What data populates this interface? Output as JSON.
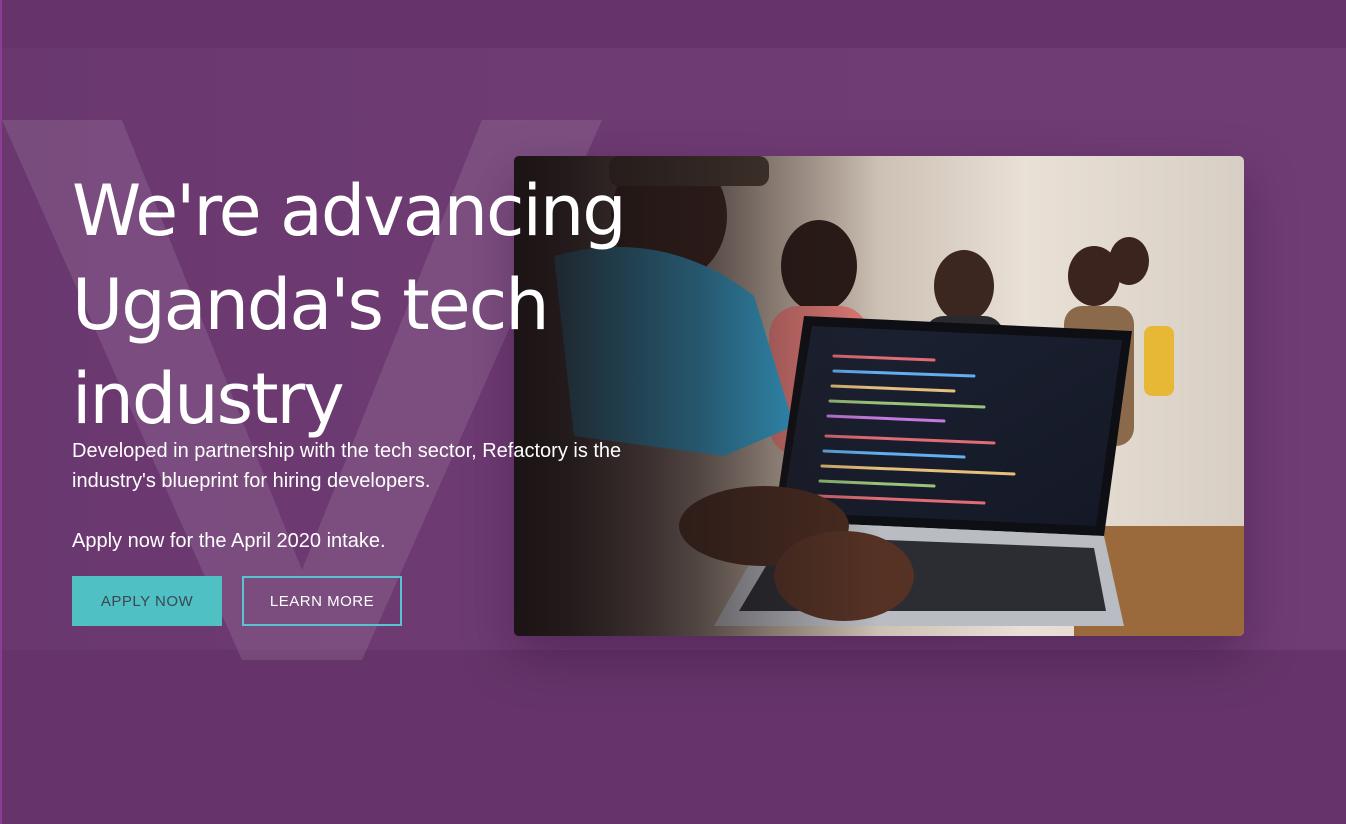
{
  "hero": {
    "headline_line1": "We're advancing",
    "headline_line2": "Uganda's tech",
    "headline_line3": "industry",
    "lead": "Developed in partnership with the tech sector, Refactory is the industry's blueprint for hiring developers.",
    "intake": "Apply now for the April 2020 intake.",
    "apply_label": "APPLY NOW",
    "learn_label": "LEARN MORE",
    "photo_alt": ""
  },
  "colors": {
    "background": "#66346a",
    "accent": "#4fc0c3",
    "outline": "#58c4d0",
    "text": "#ffffff"
  }
}
